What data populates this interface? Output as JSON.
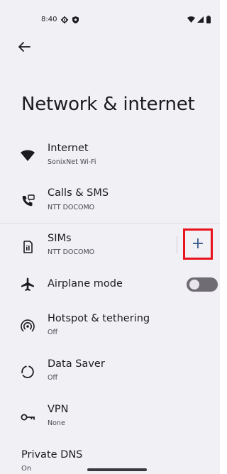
{
  "status_bar": {
    "time": "8:40",
    "left_icons": [
      "gear-icon",
      "shield-icon"
    ],
    "right_icons": [
      "wifi-icon",
      "signal-icon",
      "battery-icon"
    ]
  },
  "page": {
    "title": "Network & internet"
  },
  "items": [
    {
      "title": "Internet",
      "subtitle": "SonixNet Wi-Fi",
      "icon": "wifi-icon"
    },
    {
      "title": "Calls & SMS",
      "subtitle": "NTT DOCOMO",
      "icon": "calls-sms-icon"
    },
    {
      "title": "SIMs",
      "subtitle": "NTT DOCOMO",
      "icon": "sim-card-icon",
      "action": "+"
    },
    {
      "title": "Airplane mode",
      "subtitle": "",
      "icon": "airplane-icon",
      "toggle": "off"
    },
    {
      "title": "Hotspot & tethering",
      "subtitle": "Off",
      "icon": "hotspot-icon"
    },
    {
      "title": "Data Saver",
      "subtitle": "Off",
      "icon": "data-saver-icon"
    },
    {
      "title": "VPN",
      "subtitle": "None",
      "icon": "vpn-key-icon"
    },
    {
      "title": "Private DNS",
      "subtitle": "On"
    }
  ],
  "colors": {
    "background": "#f1f0f5",
    "highlight_border": "#e8131b",
    "add_button_accent": "#3d5a8a",
    "toggle_off_track": "#6f6c74"
  }
}
